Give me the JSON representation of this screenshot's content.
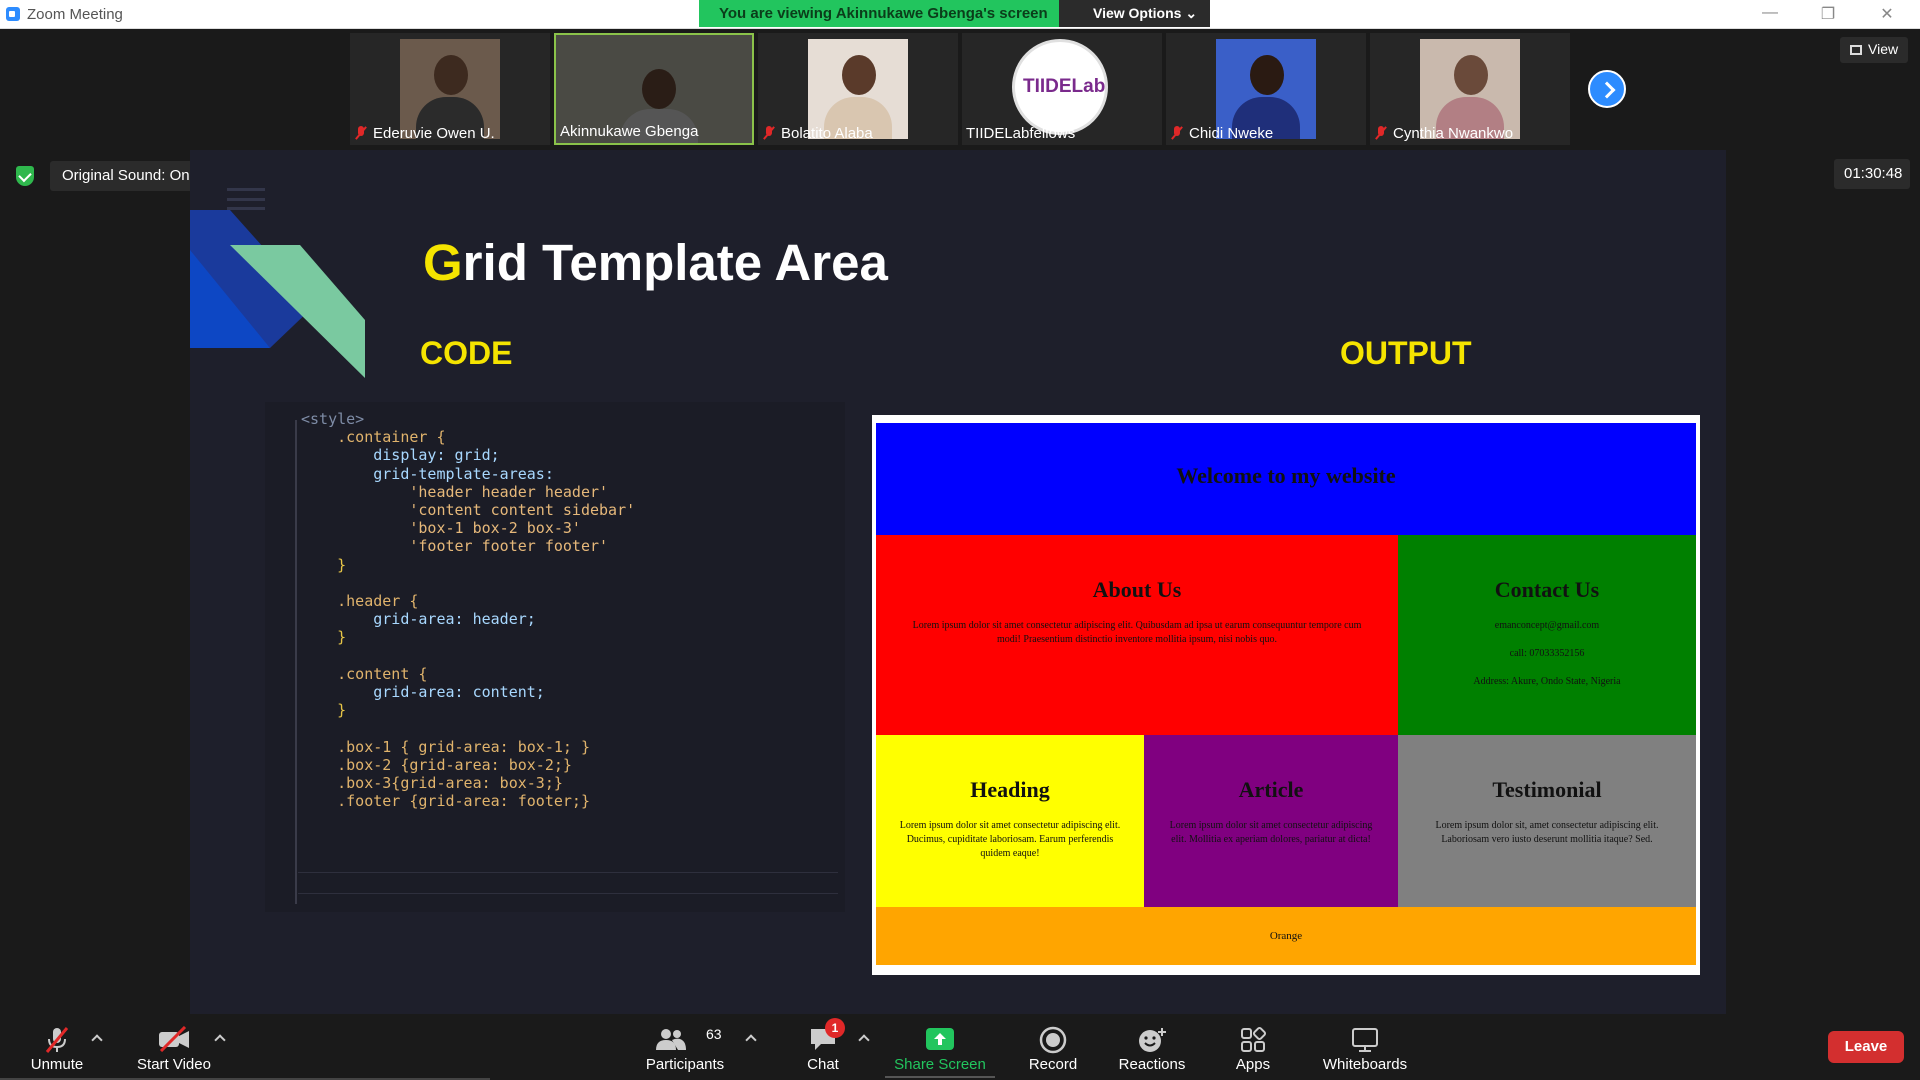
{
  "window": {
    "title": "Zoom Meeting",
    "banner": "You are viewing Akinnukawe Gbenga's screen",
    "view_options": "View Options ⌄"
  },
  "participants_strip": {
    "tiles": [
      {
        "name": "Ederuvie Owen U.",
        "muted": true
      },
      {
        "name": "Akinnukawe Gbenga",
        "muted": false,
        "active": true
      },
      {
        "name": "Bolatito Alaba",
        "muted": true
      },
      {
        "name": "TIIDELabfellows",
        "muted": false
      },
      {
        "name": "Chidi Nweke",
        "muted": true
      },
      {
        "name": "Cynthia Nwankwo",
        "muted": true
      }
    ],
    "view_label": "View"
  },
  "audio": {
    "original_sound": "Original Sound: On"
  },
  "timer": "01:30:48",
  "tiidelab_logo_text": "TIIDELab",
  "slide": {
    "title_first": "G",
    "title_rest": "rid Template Area",
    "code_heading": "CODE",
    "output_heading": "OUTPUT",
    "code_lines": [
      "<style>",
      "    .container {",
      "        display: grid;",
      "        grid-template-areas:",
      "            'header header header'",
      "            'content content sidebar'",
      "            'box-1 box-2 box-3'",
      "            'footer footer footer'",
      "    }",
      "",
      "    .header {",
      "        grid-area: header;",
      "    }",
      "",
      "    .content {",
      "        grid-area: content;",
      "    }",
      "",
      "    .box-1 { grid-area: box-1; }",
      "    .box-2 {grid-area: box-2;}",
      "    .box-3{grid-area: box-3;}",
      "    .footer {grid-area: footer;}"
    ],
    "output": {
      "header": "Welcome to my website",
      "about_title": "About Us",
      "about_text": "Lorem ipsum dolor sit amet consectetur adipiscing elit. Quibusdam ad ipsa ut earum consequuntur tempore cum modi! Praesentium distinctio inventore mollitia ipsum, nisi nobis quo.",
      "contact_title": "Contact Us",
      "contact_email": "emanconcept@gmail.com",
      "contact_call": "call: 07033352156",
      "contact_address": "Address: Akure, Ondo State, Nigeria",
      "heading_title": "Heading",
      "heading_text": "Lorem ipsum dolor sit amet consectetur adipiscing elit. Ducimus, cupiditate laboriosam. Earum perferendis quidem eaque!",
      "article_title": "Article",
      "article_text": "Lorem ipsum dolor sit amet consectetur adipiscing elit. Mollitia ex aperiam dolores, pariatur at dicta!",
      "testimonial_title": "Testimonial",
      "testimonial_text": "Lorem ipsum dolor sit, amet consectetur adipiscing elit. Laboriosam vero iusto deserunt mollitia itaque? Sed.",
      "footer": "Orange",
      "colors": {
        "header": "#0000ff",
        "content": "#ff0000",
        "sidebar": "#008000",
        "box1": "#ffff00",
        "box2": "#800080",
        "box3": "#808080",
        "footer": "#ffa500"
      }
    }
  },
  "toolbar": {
    "unmute": "Unmute",
    "start_video": "Start Video",
    "participants": "Participants",
    "participants_count": "63",
    "chat": "Chat",
    "chat_badge": "1",
    "share_screen": "Share Screen",
    "record": "Record",
    "reactions": "Reactions",
    "apps": "Apps",
    "whiteboards": "Whiteboards",
    "leave": "Leave"
  },
  "colors": {
    "accent": "#2d8cff",
    "banner_green": "#22c55e",
    "slide_yellow": "#f5e400",
    "leave_red": "#d32f2f"
  }
}
